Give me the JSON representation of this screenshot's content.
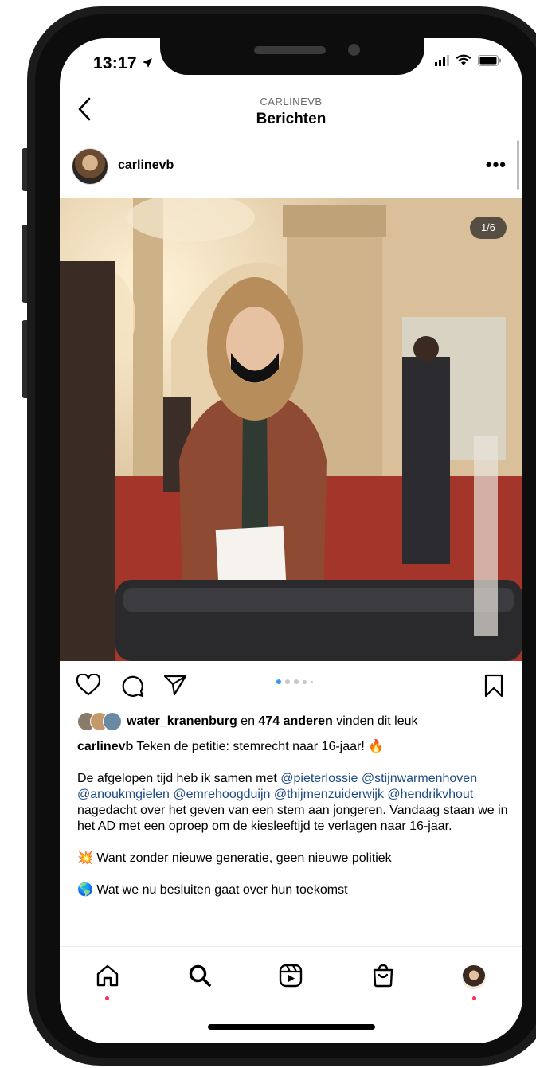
{
  "status": {
    "time": "13:17"
  },
  "header": {
    "back_icon": "chevron-left-icon",
    "username": "CARLINEVB",
    "title": "Berichten"
  },
  "post": {
    "username": "carlinevb",
    "more_icon": "more-horizontal-icon",
    "image_counter": "1/6",
    "carousel": {
      "total": 5,
      "active_index": 0
    },
    "actions": [
      "heart-icon",
      "comment-icon",
      "share-icon",
      "bookmark-icon"
    ],
    "likes": {
      "user": "water_kranenburg",
      "connector": " en ",
      "count_text": "474 anderen",
      "suffix": " vinden dit leuk"
    },
    "caption": {
      "username": "carlinevb",
      "headline": " Teken de petitie: stemrecht naar 16-jaar! ",
      "headline_emoji": "🔥",
      "para1_start": "De afgelopen tijd heb ik samen met ",
      "mentions": [
        "@pieterlossie",
        "@stijnwarmenhoven",
        "@anoukmgielen",
        "@emrehoogduijn",
        "@thijmenzuiderwijk",
        "@hendrikvhout"
      ],
      "para1_end": " nagedacht over het geven van een stem aan jongeren. Vandaag staan we in het AD met een oproep om de kiesleeftijd te verlagen naar 16-jaar.",
      "line2_emoji": "💥",
      "line2": " Want zonder nieuwe generatie, geen nieuwe politiek",
      "line3_emoji": "🌎",
      "line3": " Wat we nu besluiten gaat over hun toekomst"
    }
  },
  "tabbar": {
    "items": [
      "home-icon",
      "search-icon",
      "reels-icon",
      "shop-icon",
      "profile-avatar"
    ]
  },
  "colors": {
    "mention": "#1e4b85",
    "carousel_active": "#3897f0",
    "notification_dot": "#ff2d55"
  }
}
